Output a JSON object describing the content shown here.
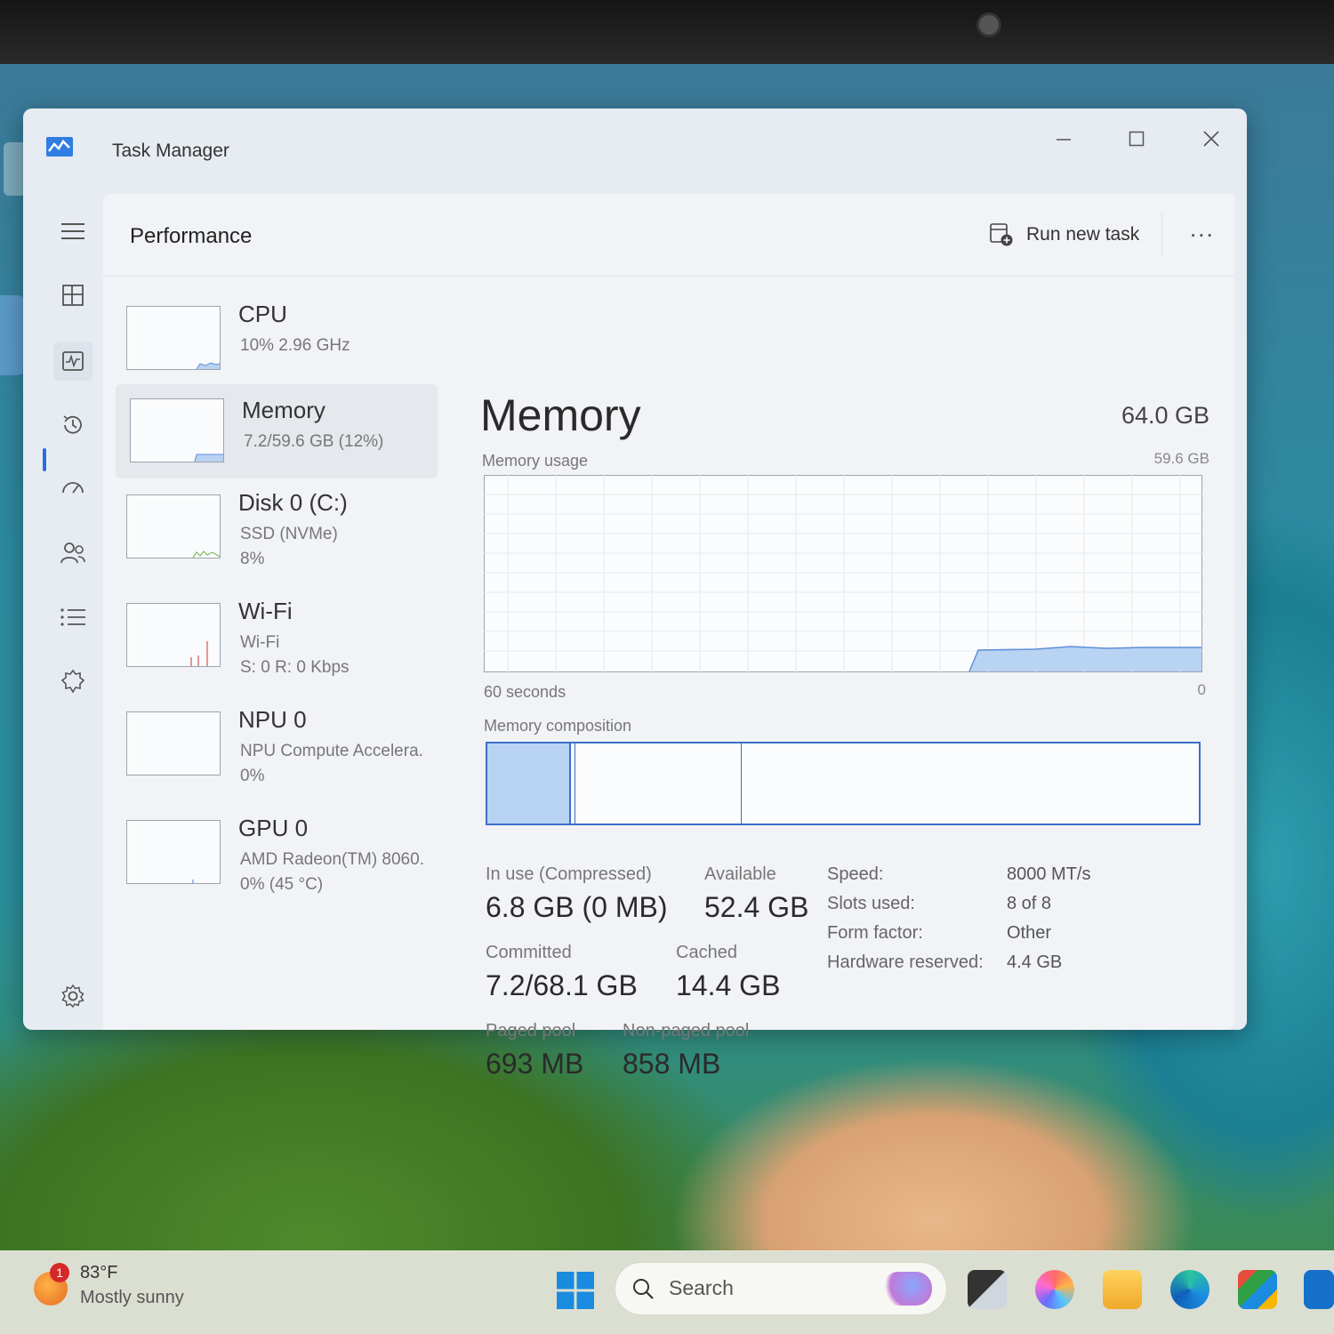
{
  "window": {
    "title": "Task Manager"
  },
  "header": {
    "page_title": "Performance",
    "run_new_task": "Run new task",
    "more": "..."
  },
  "nav_icons": [
    "menu-icon",
    "processes-icon",
    "performance-icon",
    "app-history-icon",
    "startup-apps-icon",
    "users-icon",
    "details-icon",
    "services-icon",
    "settings-icon"
  ],
  "devices": [
    {
      "name": "CPU",
      "line1": "10%  2.96 GHz",
      "line2": ""
    },
    {
      "name": "Memory",
      "line1": "7.2/59.6 GB (12%)",
      "line2": ""
    },
    {
      "name": "Disk 0 (C:)",
      "line1": "SSD (NVMe)",
      "line2": "8%"
    },
    {
      "name": "Wi-Fi",
      "line1": "Wi-Fi",
      "line2": "S: 0  R: 0 Kbps"
    },
    {
      "name": "NPU 0",
      "line1": "NPU Compute Accelera.",
      "line2": "0%"
    },
    {
      "name": "GPU 0",
      "line1": "AMD Radeon(TM) 8060.",
      "line2": "0%  (45 °C)"
    }
  ],
  "memory": {
    "title": "Memory",
    "total": "64.0 GB",
    "usage_label": "Memory usage",
    "usage_max": "59.6 GB",
    "axis_left": "60 seconds",
    "axis_right": "0",
    "composition_label": "Memory composition",
    "in_use_label": "In use (Compressed)",
    "in_use_value": "6.8 GB (0 MB)",
    "available_label": "Available",
    "available_value": "52.4 GB",
    "committed_label": "Committed",
    "committed_value": "7.2/68.1 GB",
    "cached_label": "Cached",
    "cached_value": "14.4 GB",
    "paged_label": "Paged pool",
    "paged_value": "693 MB",
    "nonpaged_label": "Non-paged pool",
    "nonpaged_value": "858 MB",
    "speed_label": "Speed:",
    "speed_value": "8000 MT/s",
    "slots_label": "Slots used:",
    "slots_value": "8 of 8",
    "form_label": "Form factor:",
    "form_value": "Other",
    "hwres_label": "Hardware reserved:",
    "hwres_value": "4.4 GB"
  },
  "taskbar": {
    "temp": "83°F",
    "condition": "Mostly sunny",
    "badge": "1",
    "search_placeholder": "Search"
  },
  "colors": {
    "accent": "#2a6fd6",
    "graph_fill": "#b9d3f3",
    "graph_line": "#5d8fd8"
  }
}
